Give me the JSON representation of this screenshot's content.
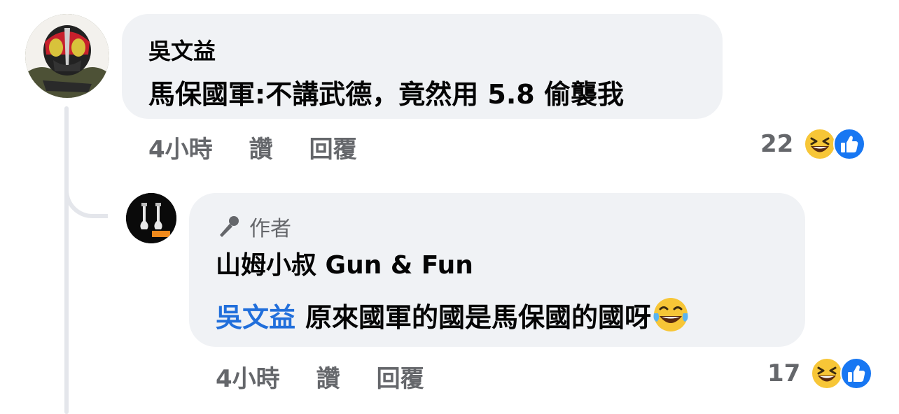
{
  "thread": {
    "comment": {
      "author": "吳文益",
      "text": "馬保國軍:不講武德，竟然用 5.8 偷襲我",
      "time": "4小時",
      "like_label": "讚",
      "reply_label": "回覆",
      "reaction_count": "22",
      "reactions": [
        "laughing-emoji",
        "like-thumb"
      ]
    },
    "reply": {
      "badge_label": "作者",
      "author": "山姆小叔 Gun & Fun",
      "mention": "吳文益",
      "text": "原來國軍的國是馬保國的國呀",
      "emoji": "tears-of-joy-emoji",
      "time": "4小時",
      "like_label": "讚",
      "reply_label": "回覆",
      "reaction_count": "17",
      "reactions": [
        "laughing-emoji",
        "like-thumb"
      ]
    },
    "logo_text": {
      "left": "山姆小叔",
      "right": "Gun&Fun"
    }
  },
  "colors": {
    "bubble": "#f0f2f5",
    "mention": "#216fdb",
    "meta": "#65676b",
    "like": "#1877f2",
    "emoji_face": "#f7c637"
  }
}
